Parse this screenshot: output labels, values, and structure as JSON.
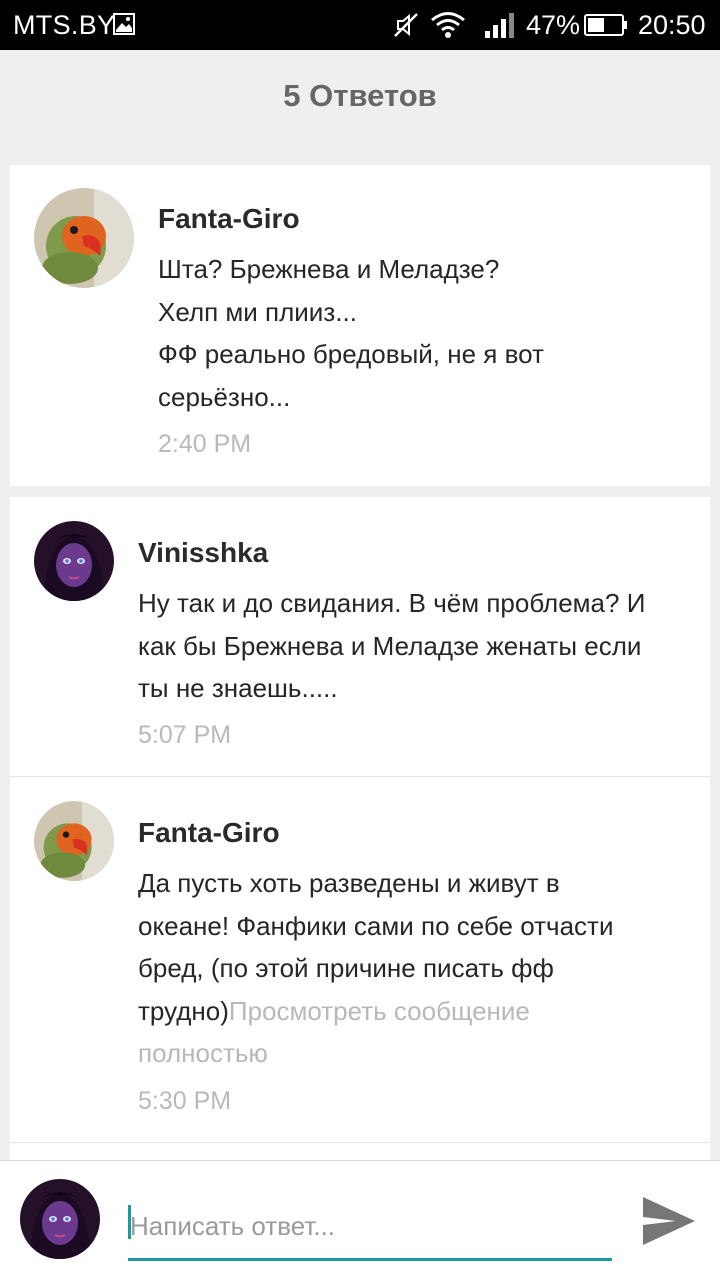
{
  "status_bar": {
    "carrier": "MTS.BY",
    "battery_percent": "47%",
    "time": "20:50",
    "icons": [
      "image-icon",
      "mute-icon",
      "wifi-icon",
      "signal-icon",
      "battery-icon"
    ]
  },
  "header": {
    "title": "5 Ответов"
  },
  "comments": [
    {
      "author": "Fanta-Giro",
      "text": "Шта? Брежнева и Меладзе?\nХелп ми плииз...\nФФ реально бредовый, не я вот\nсерьёзно...",
      "time": "2:40 PM",
      "avatar": "parrot-avatar"
    },
    {
      "author": "Vinisshka",
      "text": "Ну так и до свидания. В чём проблема? И\nкак бы Брежнева и Меладзе женаты если\nты не знаешь.....",
      "time": "5:07 PM",
      "avatar": "purple-girl-avatar"
    },
    {
      "author": "Fanta-Giro",
      "text": "Да пусть хоть разведены и живут в\nокеане! Фанфики сами по себе отчасти\nбред, (по этой причине писать фф\nтрудно)",
      "view_full": "Просмотреть сообщение\nполностью",
      "time": "5:30 PM",
      "avatar": "parrot-avatar"
    }
  ],
  "composer": {
    "placeholder": "Написать ответ...",
    "send_icon": "send-icon",
    "accent": "#1a9aa0"
  }
}
